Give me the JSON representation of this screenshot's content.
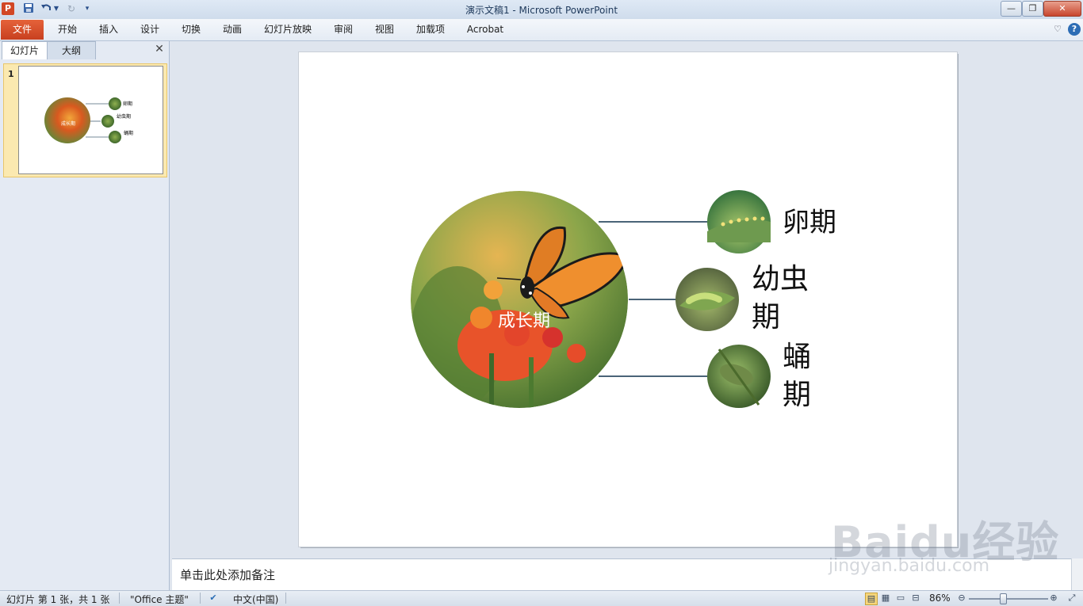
{
  "window": {
    "title": "演示文稿1  -  Microsoft PowerPoint",
    "app_icon_letter": "P"
  },
  "ribbon": {
    "file_tab": "文件",
    "tabs": [
      "开始",
      "插入",
      "设计",
      "切换",
      "动画",
      "幻灯片放映",
      "审阅",
      "视图",
      "加载项",
      "Acrobat"
    ]
  },
  "left_pane": {
    "tabs": [
      "幻灯片",
      "大纲"
    ],
    "selected_tab": "幻灯片",
    "slide_number": "1"
  },
  "slide": {
    "center_label": "成长期",
    "stages": [
      "卵期",
      "幼虫期",
      "蛹期"
    ],
    "connector_color": "#4a6478"
  },
  "thumbnail": {
    "center_label": "成长期",
    "stages": [
      "卵期",
      "幼虫期",
      "蛹期"
    ]
  },
  "notes": {
    "placeholder": "单击此处添加备注"
  },
  "statusbar": {
    "slide_info": "幻灯片 第 1 张，共 1 张",
    "theme": "\"Office 主题\"",
    "language": "中文(中国)",
    "zoom": "86%",
    "zoom_fraction": 0.86
  },
  "watermark": {
    "logo": "Baidu经验",
    "url": "jingyan.baidu.com"
  },
  "icons": [
    "powerpoint-app-icon",
    "save-icon",
    "undo-icon",
    "redo-icon",
    "customize-qat-icon",
    "minimize-icon",
    "restore-icon",
    "close-icon",
    "ribbon-minimize-icon",
    "help-icon",
    "pane-close-icon",
    "spell-check-icon",
    "normal-view-icon",
    "slide-sorter-icon",
    "reading-view-icon",
    "slideshow-icon",
    "zoom-out-icon",
    "zoom-in-icon",
    "fit-slide-icon"
  ]
}
